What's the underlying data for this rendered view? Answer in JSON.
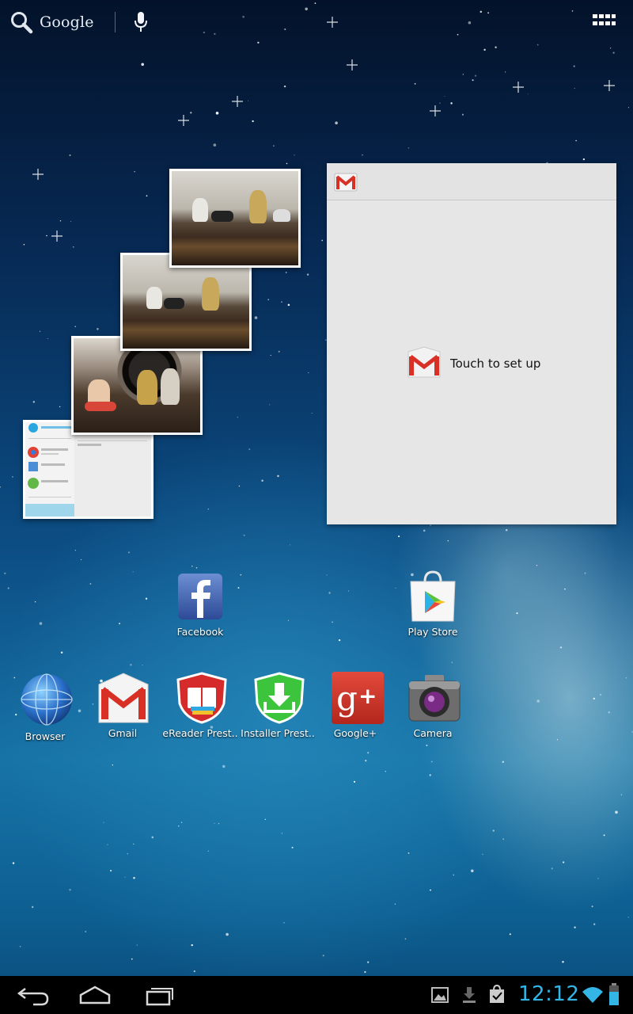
{
  "search": {
    "label": "Google"
  },
  "gmail_widget": {
    "setup_label": "Touch to set up"
  },
  "apps_row1": [
    {
      "name": "facebook",
      "label": "Facebook"
    },
    {
      "name": "play-store",
      "label": "Play Store"
    }
  ],
  "apps_row2": [
    {
      "name": "browser",
      "label": "Browser"
    },
    {
      "name": "gmail",
      "label": "Gmail"
    },
    {
      "name": "ereader",
      "label": "eReader Prest.."
    },
    {
      "name": "installer",
      "label": "Installer Prest.."
    },
    {
      "name": "google-plus",
      "label": "Google+"
    },
    {
      "name": "camera",
      "label": "Camera"
    }
  ],
  "status": {
    "time": "12:12"
  },
  "colors": {
    "clock": "#33b5e5",
    "navbar": "#000000",
    "widget_bg": "#e6e6e6"
  },
  "icons": [
    "search-icon",
    "mic-icon",
    "apps-grid-icon",
    "back-icon",
    "home-icon",
    "recents-icon",
    "gallery-icon",
    "download-icon",
    "store-bag-icon",
    "wifi-icon",
    "battery-icon"
  ]
}
